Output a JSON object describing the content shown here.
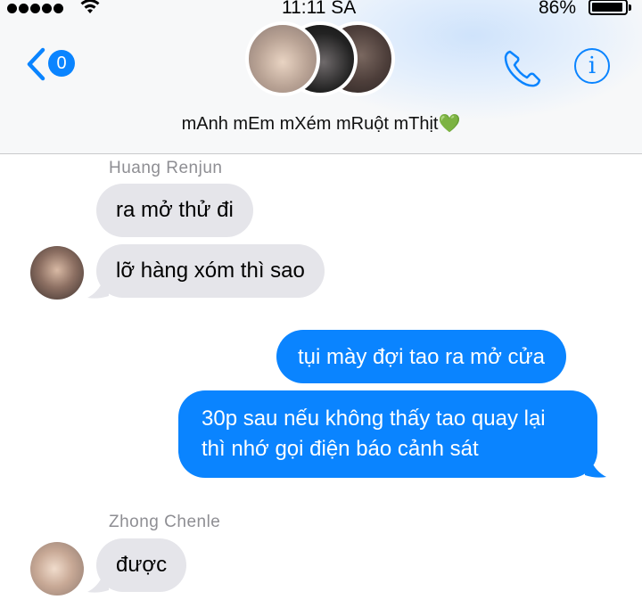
{
  "status_bar": {
    "time": "11:11 SA",
    "battery": "86%",
    "battery_level": 0.86
  },
  "header": {
    "back_badge": "0",
    "group_name": "mAnh mEm mXém mRuột mThịt💚",
    "info_label": "i"
  },
  "colors": {
    "accent": "#0a84ff",
    "incoming_bubble": "#e5e5ea",
    "outgoing_bubble": "#0a84ff",
    "sender_name": "#8e8e93"
  },
  "messages": [
    {
      "sender": "Huang Renjun",
      "direction": "incoming",
      "text": "ra mở thử đi"
    },
    {
      "direction": "incoming",
      "text": "lỡ hàng xóm thì sao"
    },
    {
      "direction": "outgoing",
      "text": "tụi mày đợi tao ra mở cửa"
    },
    {
      "direction": "outgoing",
      "text": "30p sau nếu không thấy tao quay lại thì nhớ gọi điện báo cảnh sát"
    },
    {
      "sender": "Zhong Chenle",
      "direction": "incoming",
      "text": "được"
    }
  ]
}
